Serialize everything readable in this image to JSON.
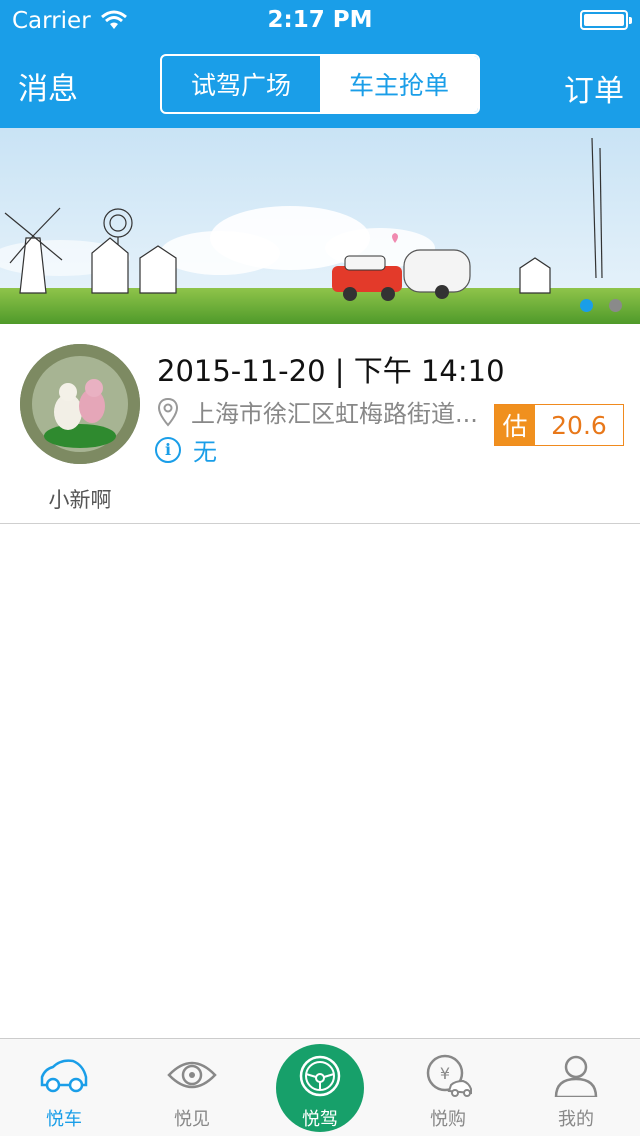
{
  "status_bar": {
    "carrier": "Carrier",
    "time": "2:17 PM"
  },
  "navbar": {
    "left": "消息",
    "right": "订单",
    "segments": [
      "试驾广场",
      "车主抢单"
    ],
    "active_segment": "试驾广场"
  },
  "banner": {
    "pages": 2,
    "current_page": 1
  },
  "order": {
    "username": "小新啊",
    "datetime": "2015-11-20 | 下午 14:10",
    "address": "上海市徐汇区虹梅路街道...",
    "note": "无",
    "estimate_label": "估",
    "estimate_value": "20.6"
  },
  "tabbar": {
    "items": [
      {
        "label": "悦车",
        "icon": "car-icon"
      },
      {
        "label": "悦见",
        "icon": "eye-icon"
      },
      {
        "label": "悦驾",
        "icon": "steering-wheel-icon"
      },
      {
        "label": "悦购",
        "icon": "yen-car-icon"
      },
      {
        "label": "我的",
        "icon": "user-icon"
      }
    ],
    "active": "悦车"
  },
  "colors": {
    "primary": "#1a9ee8",
    "accent_orange": "#f0901e",
    "center_green": "#17a06a"
  }
}
